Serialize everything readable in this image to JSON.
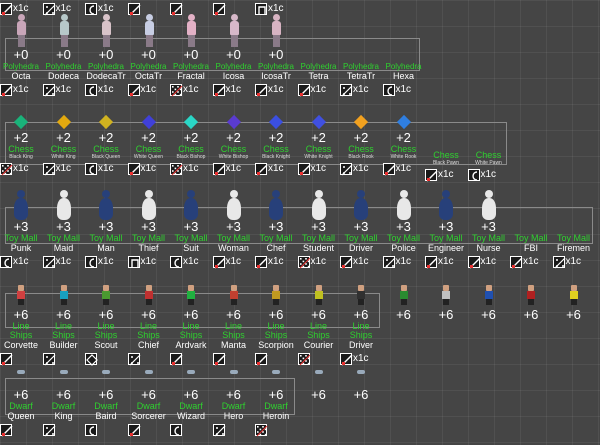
{
  "rows": [
    {
      "id": "top",
      "items": [
        {
          "card": "x",
          "count": "x1c"
        },
        {
          "card": "grid",
          "count": "x1c"
        },
        {
          "card": "c",
          "count": "x1c"
        },
        {
          "card": "x",
          "count": ""
        },
        {
          "card": "x",
          "count": ""
        },
        {
          "card": "x",
          "count": ""
        },
        {
          "card": "n",
          "count": "x1c"
        }
      ]
    },
    {
      "id": "polyhedra",
      "tag": "Polyhedra",
      "items": [
        {
          "name": "Octa",
          "plus": "+0",
          "small": "",
          "card": "x",
          "count": "x1c",
          "color": "#c9a6b9"
        },
        {
          "name": "Dodeca",
          "plus": "+0",
          "small": "",
          "card": "grid",
          "count": "x1c",
          "color": "#b7c8c9"
        },
        {
          "name": "DodecaTr",
          "plus": "+0",
          "small": "",
          "card": "c",
          "count": "x1c",
          "color": "#d8c3c9"
        },
        {
          "name": "OctaTr",
          "plus": "+0",
          "small": "",
          "card": "x",
          "count": "x1c",
          "color": "#c7cde3"
        },
        {
          "name": "Fractal",
          "plus": "+0",
          "small": "",
          "card": "dots",
          "count": "x1c",
          "color": "#e3b1c6"
        },
        {
          "name": "Icosa",
          "plus": "+0",
          "small": "",
          "card": "x",
          "count": "x1c",
          "color": "#d7b8c9"
        },
        {
          "name": "IcosaTr",
          "plus": "+0",
          "small": "",
          "card": "x",
          "count": "x1c",
          "color": "#d7b3c2"
        },
        {
          "name": "Tetra",
          "plus": "",
          "small": "",
          "card": "x",
          "count": "x1c",
          "color": ""
        },
        {
          "name": "TetraTr",
          "plus": "",
          "small": "",
          "card": "grid",
          "count": "x1c",
          "color": ""
        },
        {
          "name": "Hexa",
          "plus": "",
          "small": "",
          "card": "c",
          "count": "x1c",
          "color": ""
        }
      ]
    },
    {
      "id": "chess",
      "tag": "Chess",
      "items": [
        {
          "name": "",
          "plus": "+2",
          "small": "Black King",
          "card": "dots",
          "count": "x1c",
          "color": "#1ab37a"
        },
        {
          "name": "",
          "plus": "+2",
          "small": "White King",
          "card": "grid",
          "count": "x1c",
          "color": "#e2a90f"
        },
        {
          "name": "",
          "plus": "+2",
          "small": "Black Queen",
          "card": "c",
          "count": "x1c",
          "color": "#d0b220"
        },
        {
          "name": "",
          "plus": "+2",
          "small": "White Queen",
          "card": "x",
          "count": "x1c",
          "color": "#4040d8"
        },
        {
          "name": "",
          "plus": "+2",
          "small": "Black Bishop",
          "card": "dots",
          "count": "x1c",
          "color": "#2ad6c6"
        },
        {
          "name": "",
          "plus": "+2",
          "small": "White Bishop",
          "card": "x",
          "count": "x1c",
          "color": "#5a3bd0"
        },
        {
          "name": "",
          "plus": "+2",
          "small": "Black Knight",
          "card": "x",
          "count": "x1c",
          "color": "#3b4fe0"
        },
        {
          "name": "",
          "plus": "+2",
          "small": "White Knight",
          "card": "x",
          "count": "x1c",
          "color": "#4050e0"
        },
        {
          "name": "",
          "plus": "+2",
          "small": "Black Rook",
          "card": "grid",
          "count": "x1c",
          "color": "#f2a11f"
        },
        {
          "name": "",
          "plus": "+2",
          "small": "White Rook",
          "card": "x",
          "count": "x1c",
          "color": "#2f7ee0"
        },
        {
          "name": "",
          "plus": "",
          "small": "Black Pawn",
          "card": "x",
          "count": "x1c",
          "color": ""
        },
        {
          "name": "",
          "plus": "",
          "small": "White Pawn",
          "card": "c",
          "count": "x1c",
          "color": ""
        }
      ]
    },
    {
      "id": "toymall",
      "tag": "Toy Mall",
      "items": [
        {
          "name": "Punk",
          "plus": "+3",
          "card": "c",
          "count": "x1c",
          "color": "#27407a"
        },
        {
          "name": "Maid",
          "plus": "+3",
          "card": "grid",
          "count": "x1c",
          "color": "#e8e8e8"
        },
        {
          "name": "Man",
          "plus": "+3",
          "card": "c",
          "count": "x1c",
          "color": "#27407a"
        },
        {
          "name": "Thief",
          "plus": "+3",
          "card": "n",
          "count": "x1c",
          "color": "#e8e8e8"
        },
        {
          "name": "Suit",
          "plus": "+3",
          "card": "c",
          "count": "x1c",
          "color": "#27407a"
        },
        {
          "name": "Woman",
          "plus": "+3",
          "card": "x",
          "count": "x1c",
          "color": "#e8e8e8"
        },
        {
          "name": "Chef",
          "plus": "+3",
          "card": "x",
          "count": "x1c",
          "color": "#27407a"
        },
        {
          "name": "Student",
          "plus": "+3",
          "card": "dots",
          "count": "x1c",
          "color": "#e8e8e8"
        },
        {
          "name": "Driver",
          "plus": "+3",
          "card": "x",
          "count": "x1c",
          "color": "#27407a"
        },
        {
          "name": "Police",
          "plus": "+3",
          "card": "grid",
          "count": "x1c",
          "color": "#e8e8e8"
        },
        {
          "name": "Engineer",
          "plus": "+3",
          "card": "x",
          "count": "x1c",
          "color": "#27407a"
        },
        {
          "name": "Nurse",
          "plus": "+3",
          "card": "x",
          "count": "x1c",
          "color": "#e8e8e8"
        },
        {
          "name": "FBI",
          "plus": "",
          "card": "x",
          "count": "x1c",
          "color": ""
        },
        {
          "name": "Firemen",
          "plus": "",
          "card": "grid",
          "count": "x1c",
          "color": ""
        }
      ]
    },
    {
      "id": "lineships",
      "tag": "Line Ships",
      "items": [
        {
          "name": "Corvette",
          "plus": "+6",
          "card": "x",
          "count": "",
          "color": "#d04040"
        },
        {
          "name": "Builder",
          "plus": "+6",
          "card": "grid",
          "count": "",
          "color": "#18a0c0"
        },
        {
          "name": "Scout",
          "plus": "+6",
          "card": "d",
          "count": "",
          "color": "#4a9a30"
        },
        {
          "name": "Chief",
          "plus": "+6",
          "card": "grid",
          "count": "",
          "color": "#c03030"
        },
        {
          "name": "Ardvark",
          "plus": "+6",
          "card": "x",
          "count": "",
          "color": "#20b040"
        },
        {
          "name": "Manta",
          "plus": "+6",
          "card": "x",
          "count": "",
          "color": "#c04030"
        },
        {
          "name": "Scorpion",
          "plus": "+6",
          "card": "x",
          "count": "",
          "color": "#c09a20"
        },
        {
          "name": "Courier",
          "plus": "+6",
          "card": "dots",
          "count": "",
          "color": "#c0c020"
        },
        {
          "name": "Driver",
          "plus": "+6",
          "card": "x",
          "count": "x1c",
          "color": "#303030"
        },
        {
          "name": "",
          "plus": "+6",
          "card": "",
          "count": "",
          "color": "#2a8a30"
        },
        {
          "name": "",
          "plus": "+6",
          "card": "",
          "count": "",
          "color": "#c0c0c0"
        },
        {
          "name": "",
          "plus": "+6",
          "card": "",
          "count": "",
          "color": "#2050b0"
        },
        {
          "name": "",
          "plus": "+6",
          "card": "",
          "count": "",
          "color": "#b02020"
        },
        {
          "name": "",
          "plus": "+6",
          "card": "",
          "count": "",
          "color": "#e0d020"
        }
      ]
    },
    {
      "id": "dwarf",
      "tag": "Dwarf",
      "items": [
        {
          "name": "Queen",
          "plus": "+6",
          "card": "x",
          "count": ""
        },
        {
          "name": "King",
          "plus": "+6",
          "card": "grid",
          "count": ""
        },
        {
          "name": "Baird",
          "plus": "+6",
          "card": "c",
          "count": ""
        },
        {
          "name": "Sorcerer",
          "plus": "+6",
          "card": "x",
          "count": ""
        },
        {
          "name": "Wizard",
          "plus": "+6",
          "card": "c",
          "count": ""
        },
        {
          "name": "Hero",
          "plus": "+6",
          "card": "grid",
          "count": ""
        },
        {
          "name": "Heroin",
          "plus": "+6",
          "card": "dots",
          "count": ""
        },
        {
          "name": "",
          "plus": "+6",
          "card": "",
          "count": ""
        },
        {
          "name": "",
          "plus": "+6",
          "card": "",
          "count": ""
        }
      ]
    }
  ]
}
